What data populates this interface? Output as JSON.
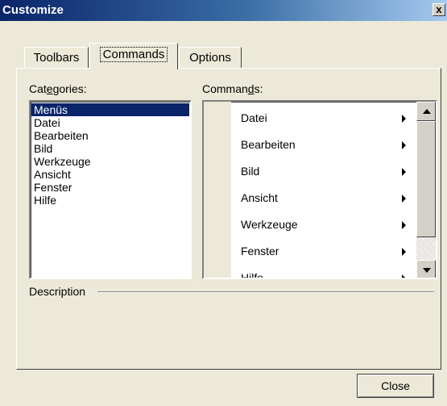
{
  "window": {
    "title": "Customize",
    "close_glyph": "x"
  },
  "tabs": [
    {
      "label": "Toolbars",
      "active": false
    },
    {
      "label": "Commands",
      "active": true
    },
    {
      "label": "Options",
      "active": false
    }
  ],
  "categories": {
    "label_pre": "Cat",
    "label_u": "e",
    "label_post": "gories:",
    "items": [
      "Menüs",
      "Datei",
      "Bearbeiten",
      "Bild",
      "Werkzeuge",
      "Ansicht",
      "Fenster",
      "Hilfe"
    ],
    "selected": "Menüs"
  },
  "commands": {
    "label_pre": "Comman",
    "label_u": "d",
    "label_post": "s:",
    "items": [
      "Datei",
      "Bearbeiten",
      "Bild",
      "Ansicht",
      "Werkzeuge",
      "Fenster",
      "Hilfe"
    ]
  },
  "description": {
    "label": "Description"
  },
  "buttons": {
    "close": "Close"
  },
  "colors": {
    "selection": "#0a246a",
    "face": "#ece9d8"
  }
}
